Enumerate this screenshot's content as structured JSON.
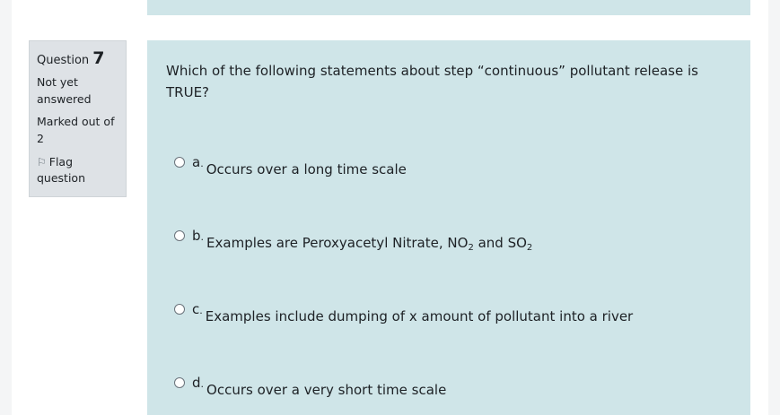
{
  "info": {
    "question_label": "Question",
    "question_number": "7",
    "state": "Not yet answered",
    "grade": "Marked out of 2",
    "flag_label": "Flag question"
  },
  "question": {
    "text": "Which of the following statements about step “continuous” pollutant release is TRUE?"
  },
  "answers": [
    {
      "letter": "a",
      "text": "Occurs over a long time scale"
    },
    {
      "letter": "b",
      "text_before": "Examples are Peroxyacetyl Nitrate, NO",
      "sub1": "2",
      "text_mid": " and SO",
      "sub2": "2"
    },
    {
      "letter": "c",
      "text": "Examples include dumping of x amount of pollutant into a river"
    },
    {
      "letter": "d",
      "text": "Occurs over a very short time scale"
    }
  ],
  "colors": {
    "content_bg": "#cfe5e8",
    "info_bg": "#dee2e6"
  },
  "icons": [
    "flag-icon",
    "radio-button"
  ]
}
